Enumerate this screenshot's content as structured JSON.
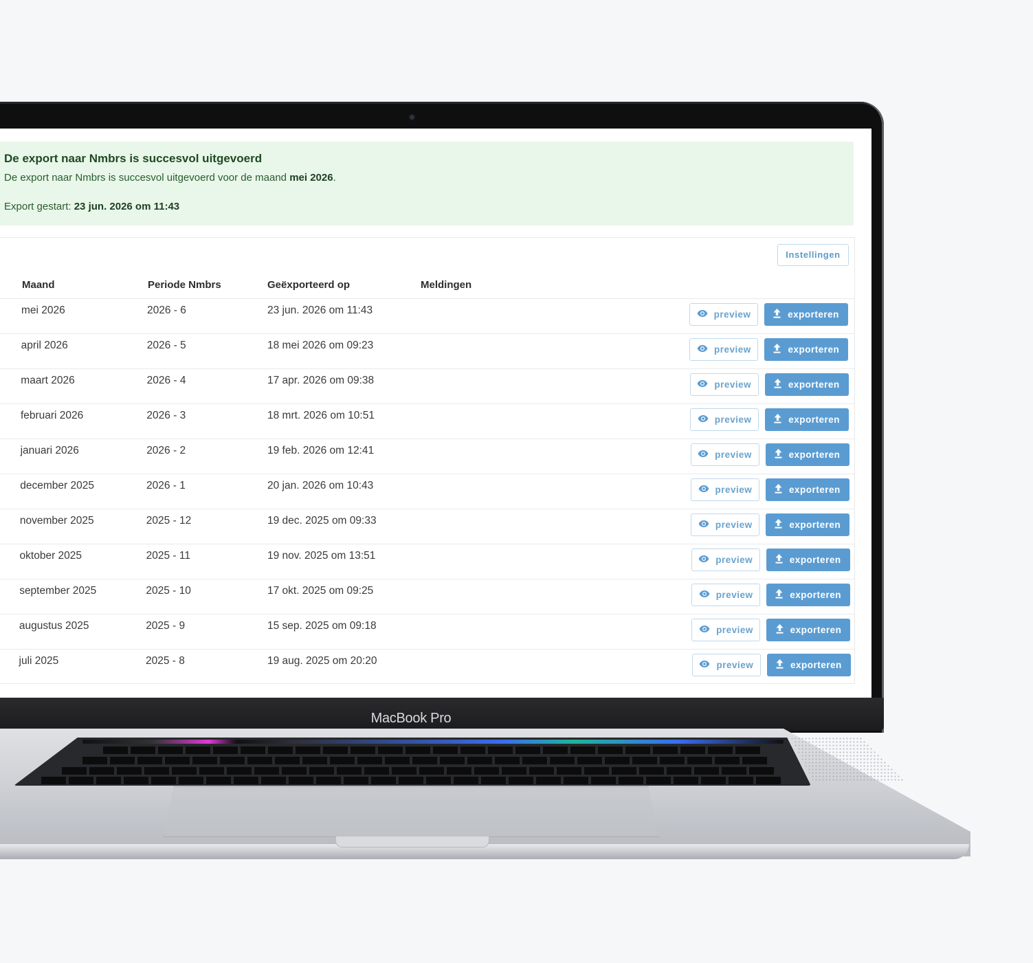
{
  "device": {
    "brand": "MacBook Pro"
  },
  "colors": {
    "alert_bg": "#e9f6ea",
    "accent": "#5a9cd2",
    "outline": "#bfd9ec"
  },
  "alert": {
    "title": "De export naar Nmbrs is succesvol uitgevoerd",
    "message_prefix": "De export naar Nmbrs is succesvol uitgevoerd voor de maand ",
    "message_month": "mei 2026",
    "message_suffix": ".",
    "started_label": "Export gestart: ",
    "started_value": "23 jun. 2026 om 11:43"
  },
  "toolbar": {
    "settings_label": "Instellingen"
  },
  "table": {
    "columns": [
      "Maand",
      "Periode Nmbrs",
      "Geëxporteerd op",
      "Meldingen"
    ],
    "rows": [
      {
        "month": "mei 2026",
        "period": "2026 - 6",
        "exported": "23 jun. 2026 om 11:43",
        "notices": "",
        "preview": "preview",
        "export": "exporteren"
      },
      {
        "month": "april 2026",
        "period": "2026 - 5",
        "exported": "18 mei 2026 om 09:23",
        "notices": "",
        "preview": "preview",
        "export": "exporteren"
      },
      {
        "month": "maart 2026",
        "period": "2026 - 4",
        "exported": "17 apr. 2026 om 09:38",
        "notices": "",
        "preview": "preview",
        "export": "exporteren"
      },
      {
        "month": "februari 2026",
        "period": "2026 - 3",
        "exported": "18 mrt. 2026 om 10:51",
        "notices": "",
        "preview": "preview",
        "export": "exporteren"
      },
      {
        "month": "januari 2026",
        "period": "2026 - 2",
        "exported": "19 feb. 2026 om 12:41",
        "notices": "",
        "preview": "preview",
        "export": "exporteren"
      },
      {
        "month": "december 2025",
        "period": "2026 - 1",
        "exported": "20 jan. 2026 om 10:43",
        "notices": "",
        "preview": "preview",
        "export": "exporteren"
      },
      {
        "month": "november 2025",
        "period": "2025 - 12",
        "exported": "19 dec. 2025 om 09:33",
        "notices": "",
        "preview": "preview",
        "export": "exporteren"
      },
      {
        "month": "oktober 2025",
        "period": "2025 - 11",
        "exported": "19 nov. 2025 om 13:51",
        "notices": "",
        "preview": "preview",
        "export": "exporteren"
      },
      {
        "month": "september 2025",
        "period": "2025 - 10",
        "exported": "17 okt. 2025 om 09:25",
        "notices": "",
        "preview": "preview",
        "export": "exporteren"
      },
      {
        "month": "augustus 2025",
        "period": "2025 - 9",
        "exported": "15 sep. 2025 om 09:18",
        "notices": "",
        "preview": "preview",
        "export": "exporteren"
      },
      {
        "month": "juli 2025",
        "period": "2025 - 8",
        "exported": "19 aug. 2025 om 20:20",
        "notices": "",
        "preview": "preview",
        "export": "exporteren"
      }
    ]
  },
  "icons": {
    "preview": "eye-icon",
    "export": "upload-icon"
  }
}
